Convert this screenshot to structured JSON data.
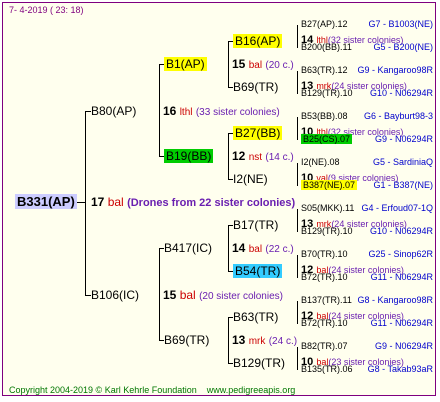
{
  "header": {
    "date": "7-  4-2019 (  23:  18)"
  },
  "footer": {
    "copyright": "Copyright 2004-2019 © Karl Kehrle Foundation",
    "url": "www.pedigreeapis.org"
  },
  "root": {
    "name": "B331(AP)",
    "count": "17",
    "code": "bal",
    "note": "(Drones from 22 sister colonies)"
  },
  "gen1": {
    "sire": {
      "name": "B80(AP)",
      "count": "16",
      "code": "lthl",
      "note": "(33 sister colonies)"
    },
    "dam": {
      "name": "B106(IC)",
      "count": "15",
      "code": "bal",
      "note": "(20 sister colonies)"
    }
  },
  "gen2": [
    {
      "name": "B1(AP)",
      "count": "15",
      "code": "bal",
      "note": "(20 c.)"
    },
    {
      "name": "B19(BB)",
      "count": "12",
      "code": "nst",
      "note": "(14 c.)"
    },
    {
      "name": "B417(IC)",
      "count": "14",
      "code": "bal",
      "note": "(22 c.)"
    },
    {
      "name": "B69(TR)",
      "count": "13",
      "code": "mrk",
      "note": "(24 c.)"
    }
  ],
  "gen3": [
    {
      "name": "B16(AP)",
      "count": "14",
      "code": "lthl",
      "note": "(32 sister colonies)"
    },
    {
      "name": "B69(TR)",
      "count": "13",
      "code": "mrk",
      "note": "(24 sister colonies)"
    },
    {
      "name": "B27(BB)",
      "count": "10",
      "code": "lthl",
      "note": "(32 sister colonies)"
    },
    {
      "name": "I2(NE)",
      "count": "10",
      "code": "val",
      "note": "(9 sister colonies)"
    },
    {
      "name": "B17(TR)",
      "count": "13",
      "code": "mrk",
      "note": "(24 sister colonies)"
    },
    {
      "name": "B54(TR)",
      "count": "12",
      "code": "bal",
      "note": "(24 sister colonies)"
    },
    {
      "name": "B63(TR)",
      "count": "12",
      "code": "bal",
      "note": "(24 sister colonies)"
    },
    {
      "name": "B129(TR)",
      "count": "10",
      "code": "bal",
      "note": "(23 sister colonies)"
    }
  ],
  "gen4": [
    {
      "left": "B27(AP).12",
      "right": "G7 - B1003(NE)"
    },
    {
      "left": "B200(BB).11",
      "right": "G5 - B200(NE)"
    },
    {
      "left": "B63(TR).12",
      "right": "G9 - Kangaroo98R"
    },
    {
      "left": "B129(TR).10",
      "right": "G10 - N06294R"
    },
    {
      "left": "B53(BB).08",
      "right": "G6 - Bayburt98-3"
    },
    {
      "left": "B25(CS).07",
      "right": "G9 - N06294R"
    },
    {
      "left": "I2(NE).08",
      "right": "G5 - SardiniaQ"
    },
    {
      "left": "B387(NE).07",
      "right": "G1 - B387(NE)"
    },
    {
      "left": "S05(MKK).11",
      "right": "G4 - Erfoud07-1Q"
    },
    {
      "left": "B129(TR).10",
      "right": "G10 - N06294R"
    },
    {
      "left": "B70(TR).10",
      "right": "G25 - Sinop62R"
    },
    {
      "left": "B72(TR).10",
      "right": "G11 - N06294R"
    },
    {
      "left": "B137(TR).11",
      "right": "G8 - Kangaroo98R"
    },
    {
      "left": "B72(TR).10",
      "right": "G11 - N06294R"
    },
    {
      "left": "B82(TR).07",
      "right": "G9 - N06294R"
    },
    {
      "left": "B135(TR).06",
      "right": "G8 - Takab93aR"
    }
  ]
}
